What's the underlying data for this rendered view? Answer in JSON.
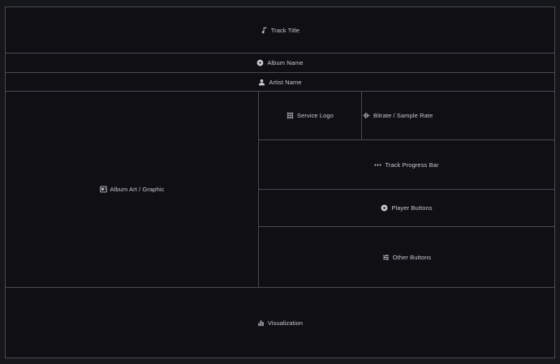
{
  "layout": {
    "track_title": "Track Title",
    "album_name": "Album Name",
    "artist_name": "Artist Name",
    "album_art": "Album Art / Graphic",
    "service_logo": "Service Logo",
    "bitrate": "Bitrate / Sample Rate",
    "progress_bar": "Track Progress Bar",
    "player_buttons": "Player Buttons",
    "other_buttons": "Other Buttons",
    "visualization": "Visualization"
  },
  "icons": {
    "track_title": "music-note-icon",
    "album_name": "disc-icon",
    "artist_name": "person-icon",
    "album_art": "image-icon",
    "service_logo": "grid-icon",
    "bitrate": "waveform-icon",
    "progress_bar": "dots-icon",
    "player_buttons": "play-circle-icon",
    "other_buttons": "sliders-icon",
    "visualization": "bar-chart-icon"
  },
  "colors": {
    "background": "#16171b",
    "panel": "#0f0f14",
    "border": "#4a4b52",
    "text": "#c9cad0"
  }
}
